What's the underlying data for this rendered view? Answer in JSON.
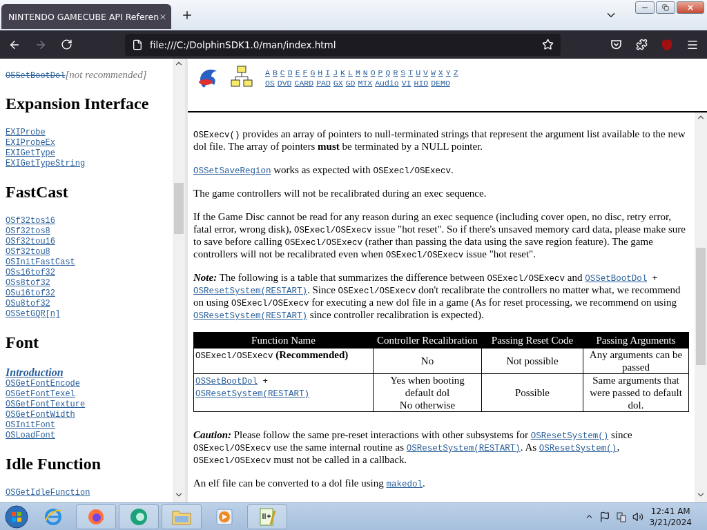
{
  "browser": {
    "tab_title": "NINTENDO GAMECUBE API Referen",
    "url": "file:///C:/DolphinSDK1.0/man/index.html"
  },
  "sidebar": {
    "items": [
      {
        "kind": "deprecated",
        "text": "OSSetBootDol",
        "note": "[not recommended]"
      },
      {
        "kind": "heading",
        "text": "Expansion Interface"
      },
      {
        "kind": "code",
        "text": "EXIProbe"
      },
      {
        "kind": "code",
        "text": "EXIProbeEx"
      },
      {
        "kind": "code",
        "text": "EXIGetType"
      },
      {
        "kind": "code",
        "text": "EXIGetTypeString"
      },
      {
        "kind": "heading",
        "text": "FastCast"
      },
      {
        "kind": "code",
        "text": "OSf32tos16"
      },
      {
        "kind": "code",
        "text": "OSf32tos8"
      },
      {
        "kind": "code",
        "text": "OSf32tou16"
      },
      {
        "kind": "code",
        "text": "OSf32tou8"
      },
      {
        "kind": "code",
        "text": "OSInitFastCast"
      },
      {
        "kind": "code",
        "text": "OSs16tof32"
      },
      {
        "kind": "code",
        "text": "OSs8tof32"
      },
      {
        "kind": "code",
        "text": "OSu16tof32"
      },
      {
        "kind": "code",
        "text": "OSu8tof32"
      },
      {
        "kind": "code",
        "text": "OSSetGQR[n]"
      },
      {
        "kind": "heading",
        "text": "Font"
      },
      {
        "kind": "intro",
        "text": "Introduction"
      },
      {
        "kind": "code",
        "text": "OSGetFontEncode"
      },
      {
        "kind": "code",
        "text": "OSGetFontTexel"
      },
      {
        "kind": "code",
        "text": "OSGetFontTexture"
      },
      {
        "kind": "code",
        "text": "OSGetFontWidth"
      },
      {
        "kind": "code",
        "text": "OSInitFont"
      },
      {
        "kind": "code",
        "text": "OSLoadFont"
      },
      {
        "kind": "heading",
        "text": "Idle Function"
      },
      {
        "kind": "code",
        "text": "OSGetIdleFunction"
      }
    ]
  },
  "header": {
    "letters": [
      "A",
      "B",
      "C",
      "D",
      "E",
      "F",
      "G",
      "H",
      "I",
      "J",
      "K",
      "L",
      "M",
      "N",
      "O",
      "P",
      "Q",
      "R",
      "S",
      "T",
      "U",
      "V",
      "W",
      "X",
      "Y",
      "Z"
    ],
    "sections": [
      "OS",
      "DVD",
      "CARD",
      "PAD",
      "GX",
      "GD",
      "MTX",
      "Audio",
      "VI",
      "HIO",
      "DEMO"
    ]
  },
  "content": {
    "blocks": [
      {
        "kind": "paragraph",
        "segments": [
          {
            "kind": "code",
            "text": "OSExecv()"
          },
          {
            "kind": "text",
            "text": " provides an array of pointers to null-terminated strings that represent the argument list available to the new dol file. The array of pointers "
          },
          {
            "kind": "bold",
            "text": "must"
          },
          {
            "kind": "text",
            "text": " be terminated by a NULL pointer."
          }
        ]
      },
      {
        "kind": "paragraph",
        "segments": [
          {
            "kind": "link",
            "text": "OSSetSaveRegion"
          },
          {
            "kind": "text",
            "text": " works as expected with "
          },
          {
            "kind": "code",
            "text": "OSExecl/OSExecv"
          },
          {
            "kind": "text",
            "text": "."
          }
        ]
      },
      {
        "kind": "paragraph",
        "segments": [
          {
            "kind": "text",
            "text": "The game controllers will not be recalibrated during an exec sequence."
          }
        ]
      },
      {
        "kind": "paragraph",
        "segments": [
          {
            "kind": "text",
            "text": "If the Game Disc cannot be read for any reason during an exec sequence (including cover open, no disc, retry error, fatal error, wrong disk), "
          },
          {
            "kind": "code",
            "text": "OSExecl/OSExecv"
          },
          {
            "kind": "text",
            "text": " issue \"hot reset\". So if there's unsaved memory card data, please make sure to save before calling "
          },
          {
            "kind": "code",
            "text": "OSExecl/OSExecv"
          },
          {
            "kind": "text",
            "text": " (rather than passing the data using the save region feature). The game controllers will not be recalibrated even when "
          },
          {
            "kind": "code",
            "text": "OSExecl/OSExecv"
          },
          {
            "kind": "text",
            "text": " issue \"hot reset\"."
          }
        ]
      },
      {
        "kind": "paragraph",
        "segments": [
          {
            "kind": "label",
            "text": "Note:"
          },
          {
            "kind": "text",
            "text": " The following is a table that summarizes the difference between "
          },
          {
            "kind": "code",
            "text": "OSExecl/OSExecv"
          },
          {
            "kind": "text",
            "text": " and "
          },
          {
            "kind": "link",
            "text": "OSSetBootDol"
          },
          {
            "kind": "code",
            "text": " + "
          },
          {
            "kind": "link",
            "text": "OSResetSystem(RESTART)"
          },
          {
            "kind": "text",
            "text": ". Since "
          },
          {
            "kind": "code",
            "text": "OSExecl/OSExecv"
          },
          {
            "kind": "text",
            "text": " don't recalibrate the controllers no matter what, we recommend on using "
          },
          {
            "kind": "code",
            "text": "OSExecl/OSExecv"
          },
          {
            "kind": "text",
            "text": " for executing a new dol file in a game (As for reset processing, we recommend on using "
          },
          {
            "kind": "link",
            "text": "OSResetSystem(RESTART)"
          },
          {
            "kind": "text",
            "text": " since controller recalibration is expected)."
          }
        ]
      },
      {
        "kind": "table",
        "columns": [
          "Function Name",
          "Controller Recalibration",
          "Passing Reset Code",
          "Passing Arguments"
        ],
        "rows": [
          {
            "cells": [
              [
                {
                  "kind": "code",
                  "text": "OSExecl/OSExecv"
                },
                {
                  "kind": "bold",
                  "text": "  (Recommended)"
                }
              ],
              [
                {
                  "kind": "text",
                  "text": "No"
                }
              ],
              [
                {
                  "kind": "text",
                  "text": "Not possible"
                }
              ],
              [
                {
                  "kind": "text",
                  "text": "Any arguments can be passed"
                }
              ]
            ]
          },
          {
            "cells": [
              [
                {
                  "kind": "link",
                  "text": "OSSetBootDol"
                },
                {
                  "kind": "code",
                  "text": " + "
                },
                {
                  "kind": "link",
                  "text": "OSResetSystem(RESTART)"
                }
              ],
              [
                {
                  "kind": "text",
                  "text": "Yes when booting default dol\nNo otherwise"
                }
              ],
              [
                {
                  "kind": "text",
                  "text": "Possible"
                }
              ],
              [
                {
                  "kind": "text",
                  "text": "Same arguments that were passed to default dol."
                }
              ]
            ]
          }
        ]
      },
      {
        "kind": "paragraph",
        "segments": [
          {
            "kind": "label",
            "text": "Caution:"
          },
          {
            "kind": "text",
            "text": " Please follow the same pre-reset interactions with other subsystems for "
          },
          {
            "kind": "link",
            "text": "OSResetSystem()"
          },
          {
            "kind": "text",
            "text": " since "
          },
          {
            "kind": "code",
            "text": "OSExecl/OSExecv"
          },
          {
            "kind": "text",
            "text": " use the same internal routine as "
          },
          {
            "kind": "link",
            "text": "OSResetSystem(RESTART)"
          },
          {
            "kind": "text",
            "text": ". As "
          },
          {
            "kind": "link",
            "text": "OSResetSystem()"
          },
          {
            "kind": "text",
            "text": ", "
          },
          {
            "kind": "code",
            "text": "OSExecl/OSExecv"
          },
          {
            "kind": "text",
            "text": " must not be called in a callback."
          }
        ]
      },
      {
        "kind": "paragraph",
        "segments": [
          {
            "kind": "text",
            "text": "An elf file can be converted to a dol file using "
          },
          {
            "kind": "link",
            "text": "makedol"
          },
          {
            "kind": "text",
            "text": "."
          }
        ]
      }
    ]
  },
  "taskbar": {
    "time": "12:41 AM",
    "date": "3/21/2024"
  }
}
